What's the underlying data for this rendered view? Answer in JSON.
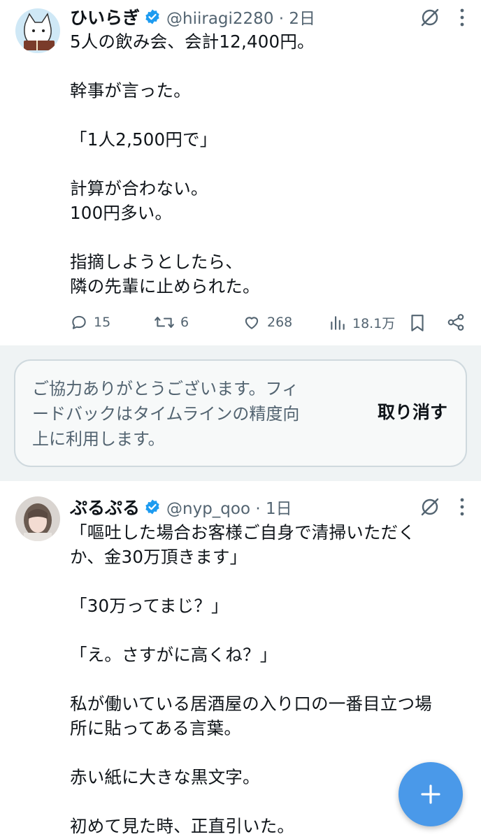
{
  "tweets": [
    {
      "display_name": "ひいらぎ",
      "handle_time": "@hiiragi2280 · 2日",
      "text": "5人の飲み会、会計12,400円。\n\n幹事が言った。\n\n「1人2,500円で」\n\n計算が合わない。\n100円多い。\n\n指摘しようとしたら、\n隣の先輩に止められた。",
      "stats": {
        "replies": "15",
        "retweets": "6",
        "likes": "268",
        "views": "18.1万"
      }
    },
    {
      "display_name": "ぷるぷる",
      "handle_time": "@nyp_qoo · 1日",
      "text": "「嘔吐した場合お客様ご自身で清掃いただく\nか、金30万頂きます」\n\n「30万ってまじ？」\n\n「え。さすがに高くね？」\n\n私が働いている居酒屋の入り口の一番目立つ場\n所に貼ってある言葉。\n\n赤い紙に大きな黒文字。\n\n初めて見た時、正直引いた。"
    }
  ],
  "feedback": {
    "message": "ご協力ありがとうございます。フィ\nードバックはタイムラインの精度向\n上に利用します。",
    "undo_label": "取り消す"
  },
  "icons": {
    "verified": "verified-badge-icon",
    "grok": "grok-icon",
    "more": "more-vertical-icon",
    "reply": "reply-icon",
    "retweet": "retweet-icon",
    "like": "like-icon",
    "views": "views-icon",
    "bookmark": "bookmark-icon",
    "share": "share-icon",
    "compose": "compose-plus-icon"
  },
  "colors": {
    "accent": "#1d9bf0",
    "fab": "#4a99e9",
    "secondary_text": "#536471",
    "feedback_bg": "#eff3f4"
  }
}
